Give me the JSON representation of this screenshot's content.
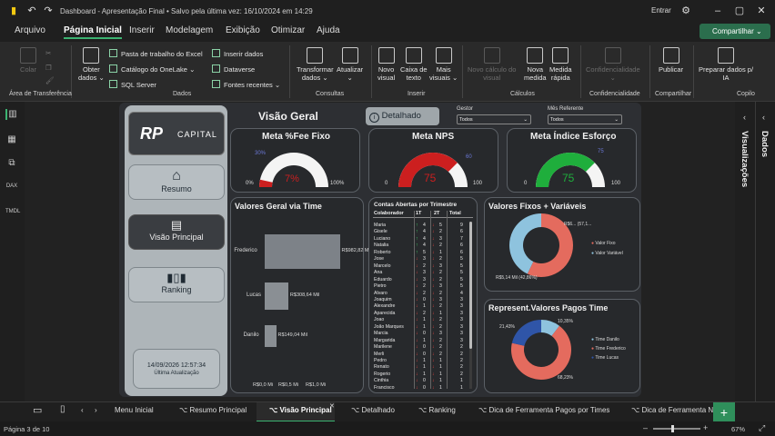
{
  "titlebar": {
    "title": "Dashboard - Apresentação Final • Salvo pela última vez: 16/10/2024 em 14:29",
    "signin": "Entrar"
  },
  "menu": {
    "items": [
      "Arquivo",
      "Página Inicial",
      "Inserir",
      "Modelagem",
      "Exibição",
      "Otimizar",
      "Ajuda"
    ],
    "share": "Compartilhar"
  },
  "ribbon": {
    "colar": "Colar",
    "obter": "Obter",
    "dados": "dados",
    "excel": "Pasta de trabalho do Excel",
    "onelake": "Catálogo do OneLake",
    "sql": "SQL Server",
    "inserir_dados": "Inserir dados",
    "dataverse": "Dataverse",
    "fontes": "Fontes recentes",
    "transformar": "Transformar",
    "transformar2": "dados",
    "atualizar": "Atualizar",
    "novo_visual": "Novo",
    "novo_visual2": "visual",
    "caixa": "Caixa de",
    "caixa2": "texto",
    "mais": "Mais",
    "mais2": "visuais",
    "novo_calc": "Novo cálculo do",
    "novo_calc2": "visual",
    "nova_medida": "Nova",
    "nova_medida2": "medida",
    "medida_rapida": "Medida",
    "medida_rapida2": "rápida",
    "confidencialidade": "Confidencialidade",
    "publicar": "Publicar",
    "preparar": "Preparar dados p/",
    "preparar2": "IA",
    "groups": [
      "Área de Transferência",
      "Dados",
      "Consultas",
      "Inserir",
      "Cálculos",
      "Confidencialidade",
      "Compartilhar",
      "Copilo"
    ]
  },
  "nav": {
    "logo_rp": "RP",
    "logo_capital": "CAPITAL",
    "resumo": "Resumo",
    "visao": "Visão Principal",
    "ranking": "Ranking",
    "datetime": "14/09/2026 12:57:34",
    "last_update": "Última Atualização"
  },
  "header": {
    "title": "Visão Geral",
    "detalhado": "Detalhado",
    "gestor_label": "Gestor",
    "gestor_value": "Todos",
    "mes_label": "Mês Referente",
    "mes_value": "Todos"
  },
  "gauges": [
    {
      "title": "Meta %Fee Fixo",
      "value": "7%",
      "min": "0%",
      "max": "100%",
      "target": "30%",
      "fill": 0.07,
      "color": "#cc1f1f"
    },
    {
      "title": "Meta NPS",
      "value": "75",
      "min": "0",
      "max": "100",
      "target": "60",
      "fill": 0.75,
      "color": "#cc1f1f"
    },
    {
      "title": "Meta Índice Esforço",
      "value": "75",
      "min": "0",
      "max": "100",
      "target": "75",
      "fill": 0.75,
      "color": "#1fae3c"
    }
  ],
  "valores_time": {
    "title": "Valores Geral via Time",
    "bars": [
      {
        "name": "Frederico",
        "label": "R$982,82 Mil",
        "value": 982.82
      },
      {
        "name": "Lucas",
        "label": "R$308,64 Mil",
        "value": 308.64
      },
      {
        "name": "Danilo",
        "label": "R$149,04 Mil",
        "value": 149.04
      }
    ],
    "ticks": [
      "R$0,0 Mi",
      "R$0,5 Mi",
      "R$1,0 Mi"
    ]
  },
  "contas": {
    "title": "Contas Abertas por Trimestre",
    "headers": [
      "Colaborador",
      "1T",
      "2T",
      "Total"
    ],
    "rows": [
      [
        "Maria",
        "up",
        "4",
        "dn",
        "5",
        "9"
      ],
      [
        "Gisele",
        "up",
        "4",
        "dn",
        "2",
        "6"
      ],
      [
        "Luciano",
        "up",
        "4",
        "dn",
        "3",
        "7"
      ],
      [
        "Natalia",
        "up",
        "4",
        "dn",
        "2",
        "6"
      ],
      [
        "Roberto",
        "up",
        "5",
        "dn",
        "1",
        "6"
      ],
      [
        "Jose",
        "dn",
        "3",
        "dn",
        "2",
        "5"
      ],
      [
        "Marcelo",
        "dn",
        "2",
        "dn",
        "3",
        "5"
      ],
      [
        "Ana",
        "dn",
        "3",
        "dn",
        "2",
        "5"
      ],
      [
        "Eduardo",
        "dn",
        "3",
        "dn",
        "2",
        "5"
      ],
      [
        "Pietro",
        "dn",
        "2",
        "dn",
        "3",
        "5"
      ],
      [
        "Alvaro",
        "dn",
        "2",
        "dn",
        "2",
        "4"
      ],
      [
        "Joaquim",
        "dn",
        "0",
        "dn",
        "3",
        "3"
      ],
      [
        "Alexandre",
        "dn",
        "1",
        "dn",
        "2",
        "3"
      ],
      [
        "Aparecida",
        "dn",
        "2",
        "dn",
        "1",
        "3"
      ],
      [
        "Joao",
        "dn",
        "1",
        "dn",
        "2",
        "3"
      ],
      [
        "João Marques",
        "dn",
        "1",
        "dn",
        "2",
        "3"
      ],
      [
        "Marcia",
        "dn",
        "0",
        "dn",
        "3",
        "3"
      ],
      [
        "Margarida",
        "dn",
        "1",
        "dn",
        "2",
        "3"
      ],
      [
        "Marilene",
        "dn",
        "0",
        "dn",
        "2",
        "2"
      ],
      [
        "Merli",
        "dn",
        "0",
        "dn",
        "2",
        "2"
      ],
      [
        "Pedro",
        "dn",
        "1",
        "dn",
        "1",
        "2"
      ],
      [
        "Renato",
        "dn",
        "1",
        "dn",
        "1",
        "2"
      ],
      [
        "Rogerio",
        "dn",
        "1",
        "dn",
        "1",
        "2"
      ],
      [
        "Cinthia",
        "dn",
        "0",
        "dn",
        "1",
        "1"
      ],
      [
        "Francisco",
        "dn",
        "0",
        "dn",
        "1",
        "1"
      ]
    ]
  },
  "fixos": {
    "title": "Valores Fixos + Variáveis",
    "label_top": "R$6... (57,1...",
    "label_bottom": "R$5,14 Mil (42,86%)",
    "legend": [
      "Valor Fixo",
      "Valor Variável"
    ],
    "slices": [
      57.14,
      42.86
    ],
    "colors": [
      "#e46b5e",
      "#8ec3de"
    ]
  },
  "represent": {
    "title": "Represent.Valores Pagos Time",
    "labels": [
      "10,35%",
      "21,43%",
      "68,23%"
    ],
    "legend": [
      "Time Danilo",
      "Time Frederico",
      "Time Lucas"
    ],
    "slices": [
      10.35,
      68.23,
      21.43
    ],
    "colors": [
      "#8ec3de",
      "#e46b5e",
      "#2f55a8"
    ]
  },
  "right": {
    "dados": "Dados",
    "visualizacoes": "Visualizações"
  },
  "tabs": [
    "Menu Inicial",
    "Resumo Principal",
    "Visão Principal",
    "Detalhado",
    "Ranking",
    "Dica de Ferramenta Pagos por Times",
    "Dica de Ferramenta Ni"
  ],
  "status": {
    "page": "Página 3 de 10",
    "zoom": "67%"
  }
}
